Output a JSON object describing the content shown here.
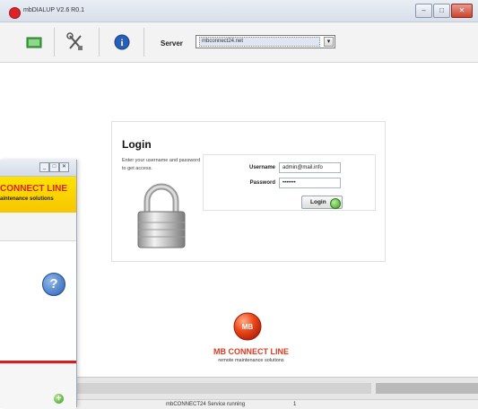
{
  "window": {
    "title": "mbDIALUP V2.6 R0.1",
    "controls": {
      "minimize": "–",
      "maximize": "□",
      "close": "✕"
    }
  },
  "toolbar": {
    "buttons": [
      {
        "name": "connect-icon",
        "color": "#3aa53a"
      },
      {
        "name": "tools-icon"
      },
      {
        "name": "info-icon",
        "label": "i",
        "color": "#2a5fb8"
      }
    ],
    "server_label": "Server",
    "server_value": "mbconnect24.net",
    "dropdown_arrow": "▾"
  },
  "login": {
    "title": "Login",
    "description": "Enter your username and password to get access.",
    "username_label": "Username",
    "username_value": "admin@mail.info",
    "password_label": "Password",
    "password_value": "•••••••",
    "button_label": "Login"
  },
  "brand": {
    "logo_text": "MB",
    "name": "MB CONNECT LINE",
    "tagline": "remote maintenance solutions",
    "color": "#e03a1e"
  },
  "status": {
    "text": "mbCONNECT24 Service running",
    "count": "1"
  },
  "background_window": {
    "controls": [
      "_",
      "□",
      "✕"
    ],
    "banner_line1": "CONNECT LINE",
    "banner_line2": "aintenance solutions",
    "help": "?",
    "add": "+"
  }
}
